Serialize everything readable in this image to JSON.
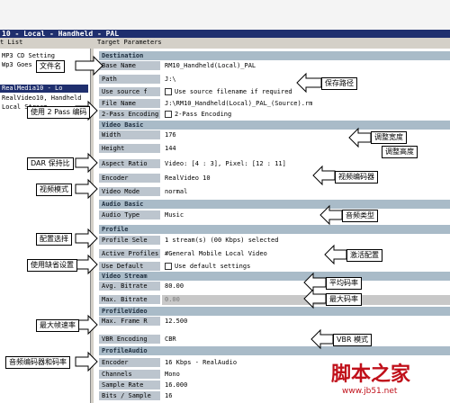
{
  "window": {
    "title": "10 - Local - Handheld - PAL",
    "left_tab": "t List",
    "right_tab": "Target Parameters"
  },
  "left_panel": {
    "items": [
      {
        "label": "MP3  CD Setting"
      },
      {
        "label": "Wp3  Goes  For"
      },
      {
        "label": "RealMedia10 - Lo"
      },
      {
        "label": "RealVideo10, Handheld"
      },
      {
        "label": "Local  Stream"
      }
    ]
  },
  "sections": {
    "destination": "Destination",
    "video_basic": "Video Basic",
    "audio_basic": "Audio Basic",
    "profile": "Profile",
    "video_stream": "Video Stream",
    "profile_video": "ProfileVideo",
    "profile_audio": "ProfileAudio"
  },
  "fields": {
    "base_name": {
      "label": "Base Name",
      "value": "RM10_Handheld(Local)_PAL"
    },
    "path": {
      "label": "Path",
      "value": "J:\\"
    },
    "use_source": {
      "label": "Use source f",
      "value": "Use source filename if required"
    },
    "file_name": {
      "label": "File Name",
      "value": "J:\\RM10_Handheld(Local)_PAL_(Source).rm"
    },
    "two_pass": {
      "label": "2-Pass Encoding",
      "value": "2-Pass Encoding"
    },
    "width": {
      "label": "Width",
      "value": "176"
    },
    "height": {
      "label": "Height",
      "value": "144"
    },
    "aspect_ratio": {
      "label": "Aspect Ratio",
      "value": "Video: [4 : 3], Pixel: [12 : 11]"
    },
    "encoder": {
      "label": "Encoder",
      "value": "RealVideo 10"
    },
    "video_mode": {
      "label": "Video Mode",
      "value": "normal"
    },
    "audio_type": {
      "label": "Audio Type",
      "value": "Music"
    },
    "profile_select": {
      "label": "Profile Sele",
      "value": "1 stream(s) (00 Kbps) selected"
    },
    "active_profiles": {
      "label": "Active Profiles",
      "value": "#General Mobile Local Video"
    },
    "use_defaults": {
      "label": "Use Default",
      "value": "Use default settings"
    },
    "avg_bitrate": {
      "label": "Avg. Bitrate",
      "value": "80.00"
    },
    "max_bitrate": {
      "label": "Max. Bitrate",
      "value": "0.00"
    },
    "max_frame_rate": {
      "label": "Max. Frame R",
      "value": "12.500"
    },
    "vbr_encoding": {
      "label": "VBR Encoding",
      "value": "CBR"
    },
    "audio_encoder": {
      "label": "Encoder",
      "value": "16 Kbps - RealAudio"
    },
    "channels": {
      "label": "Channels",
      "value": "Mono"
    },
    "sample_rate": {
      "label": "Sample Rate",
      "value": "16.000"
    },
    "bits_per_sample": {
      "label": "Bits / Sample",
      "value": "16"
    }
  },
  "callouts": {
    "filename": "文件名",
    "save_path": "保存路径",
    "two_pass": "使用 2 Pass 编码",
    "resize_width": "调整宽度",
    "resize_height": "调整高度",
    "dar": "DAR 保持比",
    "encoder": "视频编码器",
    "video_mode": "视频模式",
    "audio_type": "音频类型",
    "config_select": "配置选择",
    "active_profile": "激活配置",
    "use_default": "使用缺省设置",
    "avg_bitrate": "平均码率",
    "max_bitrate": "最大码率",
    "max_fps": "最大帧速率",
    "vbr": "VBR 模式",
    "audio_codec": "音频编码器和码率"
  },
  "watermark": {
    "text": "脚本之家",
    "url": "www.jb51.net"
  },
  "colors": {
    "title_bar": "#1f2f6e",
    "label_bg": "#bcc5ce",
    "section_bg": "#a9bbc8",
    "watermark": "#c0101a"
  }
}
